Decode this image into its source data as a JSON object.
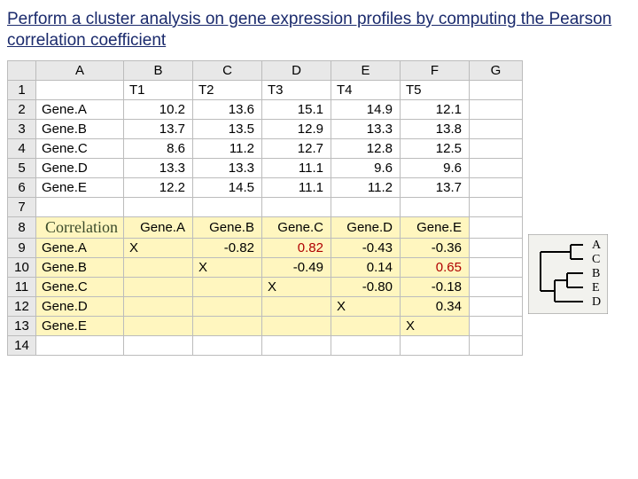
{
  "title": "Perform a cluster analysis on gene expression profiles by computing the Pearson correlation coefficient",
  "columns": [
    "A",
    "B",
    "C",
    "D",
    "E",
    "F",
    "G"
  ],
  "rows": [
    "1",
    "2",
    "3",
    "4",
    "5",
    "6",
    "7",
    "8",
    "9",
    "10",
    "11",
    "12",
    "13",
    "14"
  ],
  "header_row": {
    "B": "T1",
    "C": "T2",
    "D": "T3",
    "E": "T4",
    "F": "T5"
  },
  "genes": [
    {
      "name": "Gene.A",
      "vals": [
        "10.2",
        "13.6",
        "15.1",
        "14.9",
        "12.1"
      ]
    },
    {
      "name": "Gene.B",
      "vals": [
        "13.7",
        "13.5",
        "12.9",
        "13.3",
        "13.8"
      ]
    },
    {
      "name": "Gene.C",
      "vals": [
        "8.6",
        "11.2",
        "12.7",
        "12.8",
        "12.5"
      ]
    },
    {
      "name": "Gene.D",
      "vals": [
        "13.3",
        "13.3",
        "11.1",
        "9.6",
        "9.6"
      ]
    },
    {
      "name": "Gene.E",
      "vals": [
        "12.2",
        "14.5",
        "11.1",
        "11.2",
        "13.7"
      ]
    }
  ],
  "corr_label": "Correlation",
  "corr_cols": [
    "Gene.A",
    "Gene.B",
    "Gene.C",
    "Gene.D",
    "Gene.E"
  ],
  "corr": [
    {
      "name": "Gene.A",
      "cells": [
        {
          "v": "X"
        },
        {
          "v": "-0.82"
        },
        {
          "v": "0.82",
          "red": true
        },
        {
          "v": "-0.43"
        },
        {
          "v": "-0.36"
        }
      ]
    },
    {
      "name": "Gene.B",
      "cells": [
        {
          "v": ""
        },
        {
          "v": "X"
        },
        {
          "v": "-0.49"
        },
        {
          "v": "0.14"
        },
        {
          "v": "0.65",
          "red": true
        }
      ]
    },
    {
      "name": "Gene.C",
      "cells": [
        {
          "v": ""
        },
        {
          "v": ""
        },
        {
          "v": "X"
        },
        {
          "v": "-0.80"
        },
        {
          "v": "-0.18"
        }
      ]
    },
    {
      "name": "Gene.D",
      "cells": [
        {
          "v": ""
        },
        {
          "v": ""
        },
        {
          "v": ""
        },
        {
          "v": "X"
        },
        {
          "v": "0.34"
        }
      ]
    },
    {
      "name": "Gene.E",
      "cells": [
        {
          "v": ""
        },
        {
          "v": ""
        },
        {
          "v": ""
        },
        {
          "v": ""
        },
        {
          "v": "X"
        }
      ]
    }
  ],
  "dendro_labels": [
    "A",
    "C",
    "B",
    "E",
    "D"
  ]
}
